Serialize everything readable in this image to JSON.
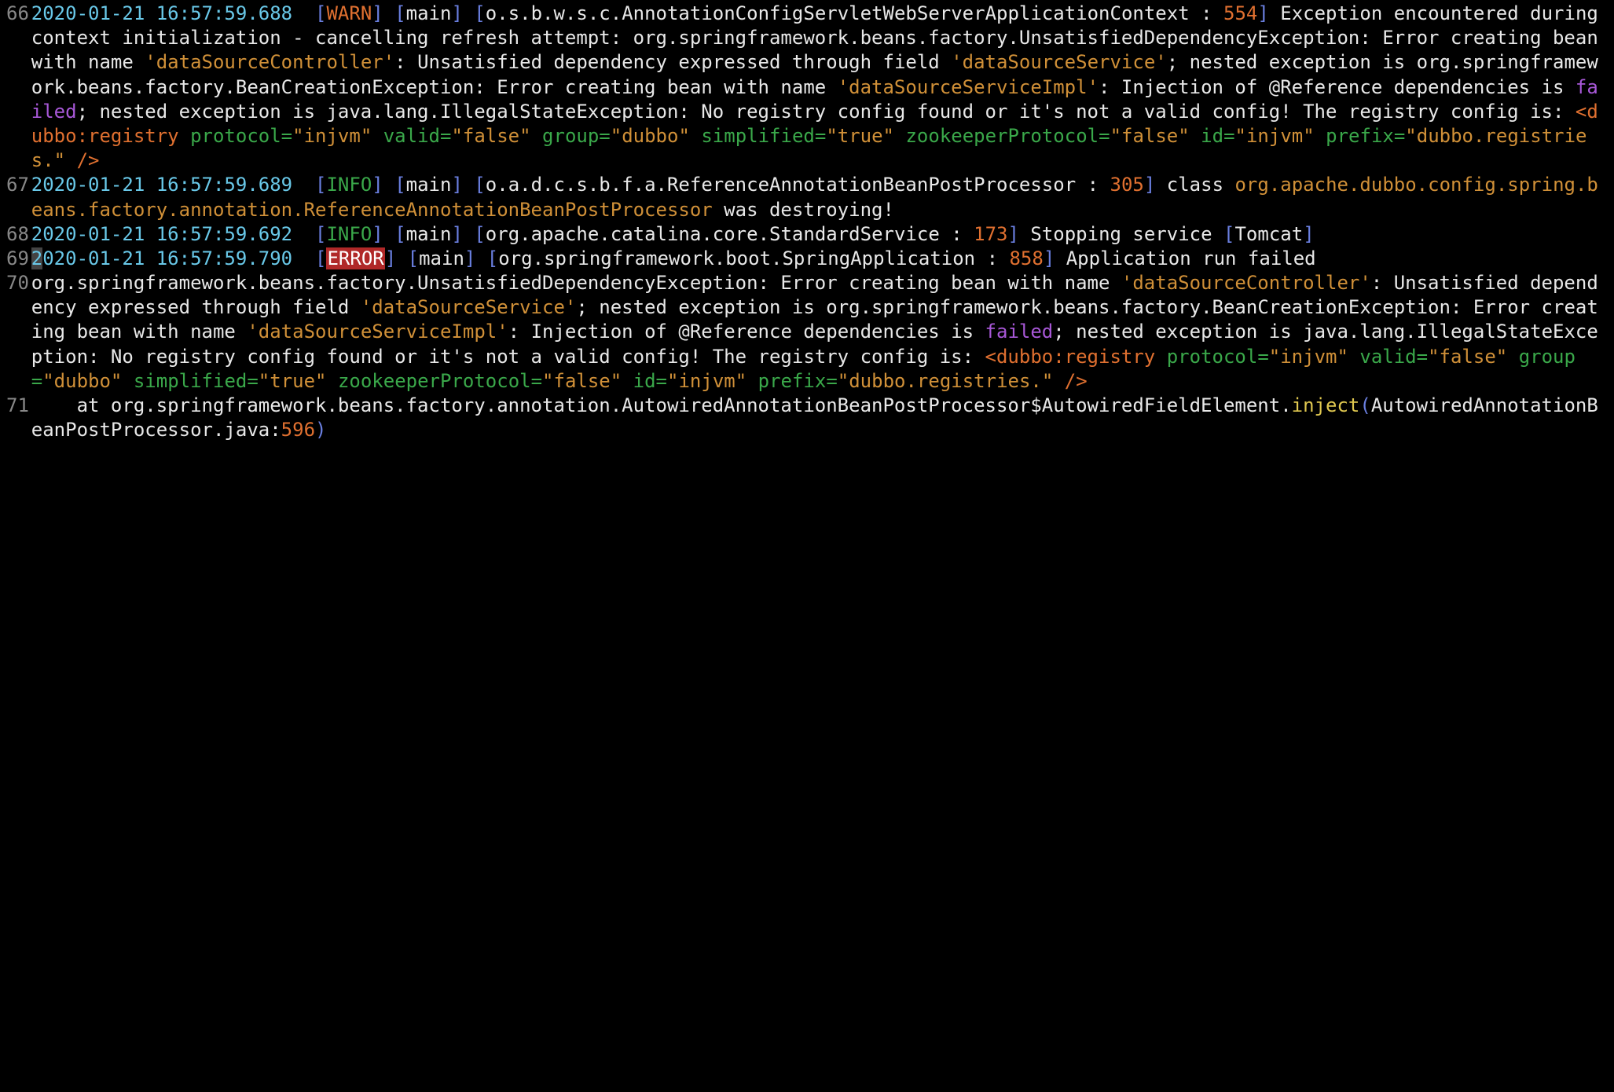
{
  "lines": [
    {
      "n": "66",
      "tokens": [
        {
          "c": "c-ts",
          "t": "2020-01-21 16:57:59.688"
        },
        {
          "c": "",
          "t": "  "
        },
        {
          "c": "c-br",
          "t": "["
        },
        {
          "c": "c-warn",
          "t": "WARN"
        },
        {
          "c": "c-br",
          "t": "]"
        },
        {
          "c": "",
          "t": " "
        },
        {
          "c": "c-br",
          "t": "["
        },
        {
          "c": "c-main",
          "t": "main"
        },
        {
          "c": "c-br",
          "t": "]"
        },
        {
          "c": "",
          "t": " "
        },
        {
          "c": "c-br",
          "t": "["
        },
        {
          "c": "c-main",
          "t": "o.s.b.w.s.c.AnnotationConfigServletWebServerApplicationContext : "
        },
        {
          "c": "c-num",
          "t": "554"
        },
        {
          "c": "c-br",
          "t": "]"
        },
        {
          "c": "",
          "t": " Exception encountered during context initialization - cancelling refresh attempt: org.springframework.beans.factory.UnsatisfiedDependencyException: Error creating bean with name "
        },
        {
          "c": "c-str",
          "t": "'dataSourceController'"
        },
        {
          "c": "",
          "t": ": Unsatisfied dependency expressed through field "
        },
        {
          "c": "c-str",
          "t": "'dataSourceService'"
        },
        {
          "c": "",
          "t": "; nested exception is org.springframework.beans.factory.BeanCreationException: Error creating bean with name "
        },
        {
          "c": "c-str",
          "t": "'dataSourceServiceImpl'"
        },
        {
          "c": "",
          "t": ": Injection of @Reference dependencies is "
        },
        {
          "c": "c-failed",
          "t": "failed"
        },
        {
          "c": "",
          "t": "; nested exception is java.lang.IllegalStateException: No registry config found or it's not a valid config! The registry config is: "
        },
        {
          "c": "c-tag",
          "t": "<dubbo:registry"
        },
        {
          "c": "",
          "t": " "
        },
        {
          "c": "c-attr",
          "t": "protocol="
        },
        {
          "c": "c-str",
          "t": "\"injvm\""
        },
        {
          "c": "",
          "t": " "
        },
        {
          "c": "c-attr",
          "t": "valid="
        },
        {
          "c": "c-str",
          "t": "\"false\""
        },
        {
          "c": "",
          "t": " "
        },
        {
          "c": "c-attr",
          "t": "group="
        },
        {
          "c": "c-str",
          "t": "\"dubbo\""
        },
        {
          "c": "",
          "t": " "
        },
        {
          "c": "c-attr",
          "t": "simplified="
        },
        {
          "c": "c-str",
          "t": "\"true\""
        },
        {
          "c": "",
          "t": " "
        },
        {
          "c": "c-attr",
          "t": "zookeeperProtocol="
        },
        {
          "c": "c-str",
          "t": "\"false\""
        },
        {
          "c": "",
          "t": " "
        },
        {
          "c": "c-attr",
          "t": "id="
        },
        {
          "c": "c-str",
          "t": "\"injvm\""
        },
        {
          "c": "",
          "t": " "
        },
        {
          "c": "c-attr",
          "t": "prefix="
        },
        {
          "c": "c-str",
          "t": "\"dubbo.registries.\""
        },
        {
          "c": "",
          "t": " "
        },
        {
          "c": "c-tag",
          "t": "/>"
        }
      ]
    },
    {
      "n": "67",
      "tokens": [
        {
          "c": "c-ts",
          "t": "2020-01-21 16:57:59.689"
        },
        {
          "c": "",
          "t": "  "
        },
        {
          "c": "c-br",
          "t": "["
        },
        {
          "c": "c-info",
          "t": "INFO"
        },
        {
          "c": "c-br",
          "t": "]"
        },
        {
          "c": "",
          "t": " "
        },
        {
          "c": "c-br",
          "t": "["
        },
        {
          "c": "c-main",
          "t": "main"
        },
        {
          "c": "c-br",
          "t": "]"
        },
        {
          "c": "",
          "t": " "
        },
        {
          "c": "c-br",
          "t": "["
        },
        {
          "c": "c-main",
          "t": "o.a.d.c.s.b.f.a.ReferenceAnnotationBeanPostProcessor : "
        },
        {
          "c": "c-num",
          "t": "305"
        },
        {
          "c": "c-br",
          "t": "]"
        },
        {
          "c": "",
          "t": " class "
        },
        {
          "c": "c-str",
          "t": "org.apache.dubbo.config.spring.beans.factory.annotation.ReferenceAnnotationBeanPostProcessor"
        },
        {
          "c": "",
          "t": " was destroying!"
        }
      ]
    },
    {
      "n": "68",
      "tokens": [
        {
          "c": "c-ts",
          "t": "2020-01-21 16:57:59.692"
        },
        {
          "c": "",
          "t": "  "
        },
        {
          "c": "c-br",
          "t": "["
        },
        {
          "c": "c-info",
          "t": "INFO"
        },
        {
          "c": "c-br",
          "t": "]"
        },
        {
          "c": "",
          "t": " "
        },
        {
          "c": "c-br",
          "t": "["
        },
        {
          "c": "c-main",
          "t": "main"
        },
        {
          "c": "c-br",
          "t": "]"
        },
        {
          "c": "",
          "t": " "
        },
        {
          "c": "c-br",
          "t": "["
        },
        {
          "c": "c-main",
          "t": "org.apache.catalina.core.StandardService : "
        },
        {
          "c": "c-num",
          "t": "173"
        },
        {
          "c": "c-br",
          "t": "]"
        },
        {
          "c": "",
          "t": " Stopping service "
        },
        {
          "c": "c-br",
          "t": "["
        },
        {
          "c": "c-main",
          "t": "Tomcat"
        },
        {
          "c": "c-br",
          "t": "]"
        }
      ]
    },
    {
      "n": "69",
      "tokens": [
        {
          "c": "c-ts c-cursor",
          "t": "2"
        },
        {
          "c": "c-ts",
          "t": "020-01-21 16:57:59.790"
        },
        {
          "c": "",
          "t": "  "
        },
        {
          "c": "c-br",
          "t": "["
        },
        {
          "c": "c-err-bg",
          "t": "ERROR"
        },
        {
          "c": "c-br",
          "t": "]"
        },
        {
          "c": "",
          "t": " "
        },
        {
          "c": "c-br",
          "t": "["
        },
        {
          "c": "c-main",
          "t": "main"
        },
        {
          "c": "c-br",
          "t": "]"
        },
        {
          "c": "",
          "t": " "
        },
        {
          "c": "c-br",
          "t": "["
        },
        {
          "c": "c-main",
          "t": "org.springframework.boot.SpringApplication : "
        },
        {
          "c": "c-num",
          "t": "858"
        },
        {
          "c": "c-br",
          "t": "]"
        },
        {
          "c": "",
          "t": " Application run failed"
        }
      ]
    },
    {
      "n": "70",
      "tokens": [
        {
          "c": "",
          "t": "org.springframework.beans.factory.UnsatisfiedDependencyException: Error creating bean with name "
        },
        {
          "c": "c-str",
          "t": "'dataSourceController'"
        },
        {
          "c": "",
          "t": ": Unsatisfied dependency expressed through field "
        },
        {
          "c": "c-str",
          "t": "'dataSourceService'"
        },
        {
          "c": "",
          "t": "; nested exception is org.springframework.beans.factory.BeanCreationException: Error creating bean with name "
        },
        {
          "c": "c-str",
          "t": "'dataSourceServiceImpl'"
        },
        {
          "c": "",
          "t": ": Injection of @Reference dependencies is "
        },
        {
          "c": "c-failed",
          "t": "failed"
        },
        {
          "c": "",
          "t": "; nested exception is java.lang.IllegalStateException: No registry config found or it's not a valid config! The registry config is: "
        },
        {
          "c": "c-tag",
          "t": "<dubbo:registry"
        },
        {
          "c": "",
          "t": " "
        },
        {
          "c": "c-attr",
          "t": "protocol="
        },
        {
          "c": "c-str",
          "t": "\"injvm\""
        },
        {
          "c": "",
          "t": " "
        },
        {
          "c": "c-attr",
          "t": "valid="
        },
        {
          "c": "c-str",
          "t": "\"false\""
        },
        {
          "c": "",
          "t": " "
        },
        {
          "c": "c-attr",
          "t": "group="
        },
        {
          "c": "c-str",
          "t": "\"dubbo\""
        },
        {
          "c": "",
          "t": " "
        },
        {
          "c": "c-attr",
          "t": "simplified="
        },
        {
          "c": "c-str",
          "t": "\"true\""
        },
        {
          "c": "",
          "t": " "
        },
        {
          "c": "c-attr",
          "t": "zookeeperProtocol="
        },
        {
          "c": "c-str",
          "t": "\"false\""
        },
        {
          "c": "",
          "t": " "
        },
        {
          "c": "c-attr",
          "t": "id="
        },
        {
          "c": "c-str",
          "t": "\"injvm\""
        },
        {
          "c": "",
          "t": " "
        },
        {
          "c": "c-attr",
          "t": "prefix="
        },
        {
          "c": "c-str",
          "t": "\"dubbo.registries.\""
        },
        {
          "c": "",
          "t": " "
        },
        {
          "c": "c-tag",
          "t": "/>"
        }
      ]
    },
    {
      "n": "71",
      "tokens": [
        {
          "c": "",
          "t": "    at org.springframework.beans.factory.annotation.AutowiredAnnotationBeanPostProcessor$AutowiredFieldElement."
        },
        {
          "c": "c-fn",
          "t": "inject"
        },
        {
          "c": "c-br",
          "t": "("
        },
        {
          "c": "",
          "t": "AutowiredAnnotationBeanPostProcessor.java:"
        },
        {
          "c": "c-num",
          "t": "596"
        },
        {
          "c": "c-br",
          "t": ")"
        }
      ]
    }
  ]
}
